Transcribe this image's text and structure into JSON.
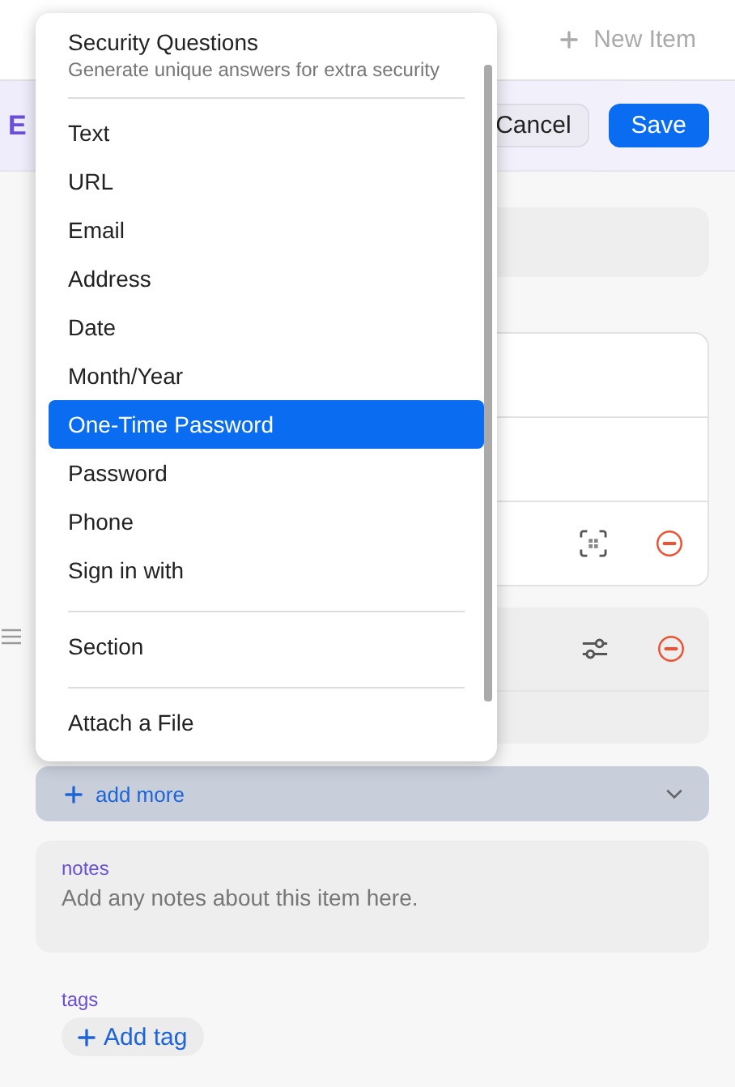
{
  "top_bar": {
    "new_item_button": "New Item"
  },
  "header": {
    "title": "E",
    "buttons": [
      {
        "label": "Cancel",
        "kind": "secondary"
      },
      {
        "label": "Save",
        "kind": "primary"
      }
    ]
  },
  "add_more": {
    "label": "add more"
  },
  "notes": {
    "label": "notes",
    "placeholder": "Add any notes about this item here."
  },
  "tags": {
    "label": "tags",
    "button": "Add tag"
  },
  "menu": {
    "title": "Security Questions",
    "subtitle": "Generate unique answers for extra security",
    "groups": [
      [
        {
          "label": "Text",
          "selected": false
        },
        {
          "label": "URL",
          "selected": false
        },
        {
          "label": "Email",
          "selected": false
        },
        {
          "label": "Address",
          "selected": false
        },
        {
          "label": "Date",
          "selected": false
        },
        {
          "label": "Month/Year",
          "selected": false
        },
        {
          "label": "One-Time Password",
          "selected": true
        },
        {
          "label": "Password",
          "selected": false
        },
        {
          "label": "Phone",
          "selected": false
        },
        {
          "label": "Sign in with",
          "selected": false
        }
      ],
      [
        {
          "label": "Section",
          "selected": false
        }
      ],
      [
        {
          "label": "Attach a File",
          "selected": false
        }
      ]
    ]
  }
}
